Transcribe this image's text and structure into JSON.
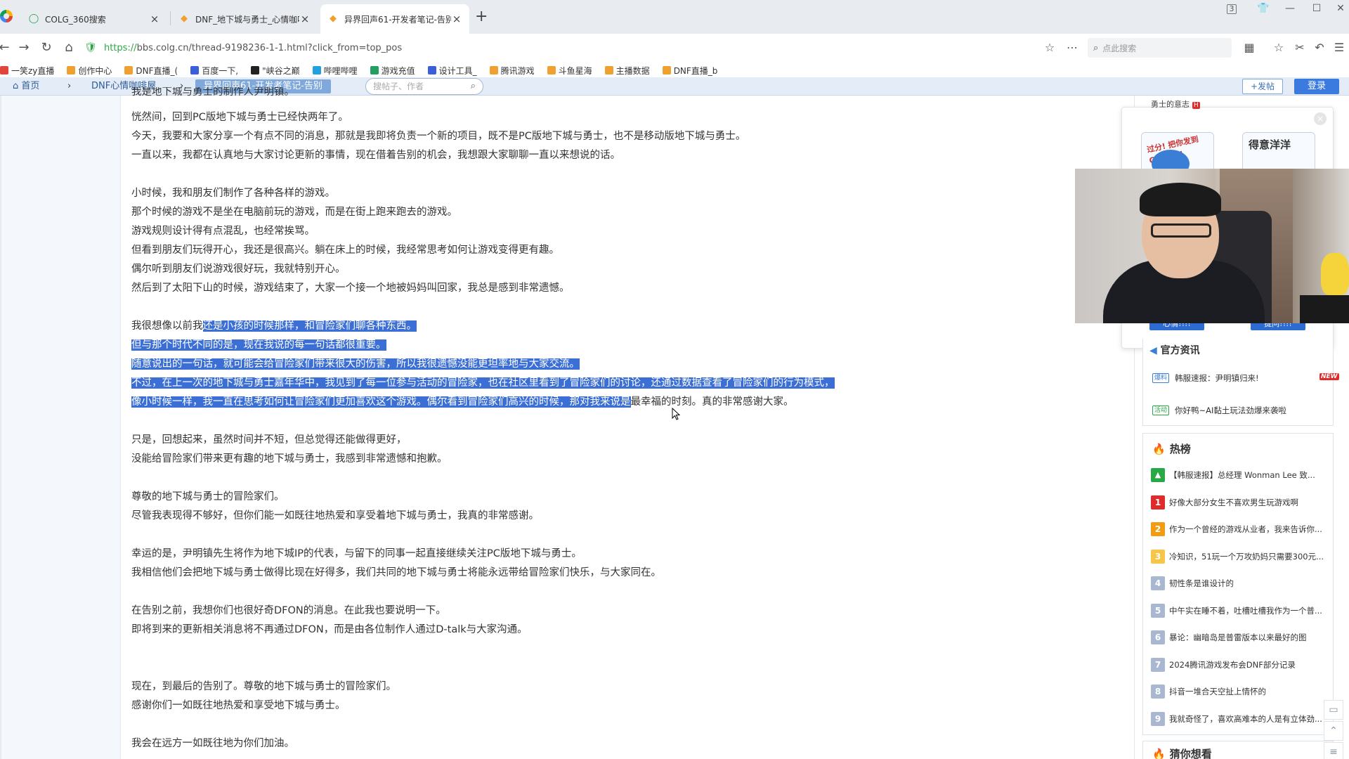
{
  "browser": {
    "tabs": [
      {
        "title": "COLG_360搜索",
        "icon": "search-circle-icon",
        "active": false
      },
      {
        "title": "DNF_地下城与勇士_心情咖啡屋",
        "icon": "colg-favicon-icon",
        "active": false
      },
      {
        "title": "异界回声61-开发者笔记-告别",
        "icon": "colg-favicon-icon",
        "active": true
      }
    ],
    "new_tab": "+",
    "tab_close": "×",
    "window_controls": {
      "counter": "3",
      "minimize": "—",
      "maximize": "☐",
      "close": "✕"
    },
    "url_secure": "https://",
    "url_rest": "bbs.colg.cn/thread-9198236-1-1.html?click_from=top_pos",
    "search_placeholder": "点此搜索",
    "bookmarks": [
      {
        "label": "一笑zy直播",
        "color": "#e0463a"
      },
      {
        "label": "创作中心",
        "color": "#f0a030"
      },
      {
        "label": "DNF直播_(",
        "color": "#f0a030"
      },
      {
        "label": "百度一下,",
        "color": "#3a5fd9"
      },
      {
        "label": "\"峡谷之巅",
        "color": "#222222"
      },
      {
        "label": "哔哩哔哩",
        "color": "#23a0e0"
      },
      {
        "label": "游戏充值",
        "color": "#23a060"
      },
      {
        "label": "设计工具_",
        "color": "#3a5fd9"
      },
      {
        "label": "腾讯游戏",
        "color": "#f0a030"
      },
      {
        "label": "斗鱼星海",
        "color": "#f0a030"
      },
      {
        "label": "主播数据",
        "color": "#f0a030"
      },
      {
        "label": "DNF直播_b",
        "color": "#f0a030"
      }
    ]
  },
  "site_nav": {
    "home": "首页",
    "forum": "DNF心情咖啡屋",
    "current": "异界回声61-开发者笔记-告别",
    "search_placeholder": "搜帖子、作者",
    "post_button": "+发帖",
    "login_button": "登录"
  },
  "article": {
    "top_partial": "我是地下城与勇士的制作人尹明镇。",
    "lines": [
      {
        "text": "恍然间，回到PC版地下城与勇士已经快两年了。"
      },
      {
        "text": "今天，我要和大家分享一个有点不同的消息，那就是我即将负责一个新的项目，既不是PC版地下城与勇士，也不是移动版地下城与勇士。"
      },
      {
        "text": "一直以来，我都在认真地与大家讨论更新的事情，现在借着告别的机会，我想跟大家聊聊一直以来想说的话。"
      },
      {
        "text": "小时候，我和朋友们制作了各种各样的游戏。"
      },
      {
        "text": "那个时候的游戏不是坐在电脑前玩的游戏，而是在街上跑来跑去的游戏。"
      },
      {
        "text": "游戏规则设计得有点混乱，也经常挨骂。"
      },
      {
        "text": "但看到朋友们玩得开心，我还是很高兴。躺在床上的时候，我经常思考如何让游戏变得更有趣。"
      },
      {
        "text": "偶尔听到朋友们说游戏很好玩，我就特别开心。"
      },
      {
        "text": "然后到了太阳下山的时候，游戏结束了，大家一个接一个地被妈妈叫回家，我总是感到非常遗憾。"
      },
      {
        "pre": "我很想像以前我",
        "hl": "还是小孩的时候那样，和冒险家们聊各种东西。",
        "post": ""
      },
      {
        "pre": "",
        "hl": "但与那个时代不同的是，现在我说的每一句话都很重要。",
        "post": ""
      },
      {
        "pre": "",
        "hl": "随意说出的一句话，就可能会给冒险家们带来很大的伤害，所以我很遗憾没能更坦率地与大家交流。",
        "post": ""
      },
      {
        "pre": "",
        "hl": "不过，在上一次的地下城与勇士嘉年华中，我见到了每一位参与活动的冒险家，也在社区里看到了冒险家们的讨论，还通过数据查看了冒险家们的行为模式，",
        "post": ""
      },
      {
        "pre": "",
        "hl": "像小时候一样，我一直在思考如何让冒险家们更加喜欢这个游戏。偶尔看到冒险家们高兴的时候，那对我来说是",
        "post": "最幸福的时刻。真的非常感谢大家。"
      },
      {
        "text": "只是，回想起来，虽然时间并不短，但总觉得还能做得更好，"
      },
      {
        "text": "没能给冒险家们带来更有趣的地下城与勇士，我感到非常遗憾和抱歉。"
      },
      {
        "text": "尊敬的地下城与勇士的冒险家们。"
      },
      {
        "text": "尽管我表现得不够好，但你们能一如既往地热爱和享受着地下城与勇士，我真的非常感谢。"
      },
      {
        "text": "幸运的是，尹明镇先生将作为地下城IP的代表，与留下的同事一起直接继续关注PC版地下城与勇士。"
      },
      {
        "text": "我相信他们会把地下城与勇士做得比现在好得多，我们共同的地下城与勇士将能永远带给冒险家们快乐，与大家同在。"
      },
      {
        "text": "在告别之前，我想你们也很好奇DFON的消息。在此我也要说明一下。"
      },
      {
        "text": "即将到来的更新相关消息将不再通过DFON，而是由各位制作人通过D-talk与大家沟通。"
      },
      {
        "text": "现在，到最后的告别了。尊敬的地下城与勇士的冒险家们。"
      },
      {
        "text": "感谢你们一如既往地热爱和享受地下城与勇士。"
      },
      {
        "text": "我会在远方一如既往地为你们加油。"
      }
    ]
  },
  "sidebar": {
    "popup": {
      "title": "勇士的意志",
      "tag": "H",
      "close": "×",
      "sticker_a": "过分! 把你发到COLG去!",
      "sticker_b": "得意洋洋",
      "button_a": "心情!!!!",
      "button_b": "提问!!!!"
    },
    "official_news": {
      "title": "官方资讯",
      "items": [
        {
          "badge": "爆料",
          "badge_class": "badge-blue",
          "text": "韩服速报：尹明镇归来!",
          "new": "NEW"
        },
        {
          "badge": "活动",
          "badge_class": "badge-green",
          "text": "你好鸭~AI黏土玩法劲爆来袭啦",
          "new": ""
        }
      ]
    },
    "hot": {
      "title": "热榜",
      "items": [
        {
          "rank": "▲",
          "class": "rank-top",
          "text": "【韩服速报】总经理 Wonman Lee 致..."
        },
        {
          "rank": "1",
          "class": "rank-1",
          "text": "好像大部分女生不喜欢男生玩游戏啊"
        },
        {
          "rank": "2",
          "class": "rank-2",
          "text": "作为一个曾经的游戏从业者，我来告诉你..."
        },
        {
          "rank": "3",
          "class": "rank-3",
          "text": "冷知识，51玩一个万攻奶妈只需要300元..."
        },
        {
          "rank": "4",
          "class": "",
          "text": "韧性条是谁设计的"
        },
        {
          "rank": "5",
          "class": "",
          "text": "中午实在睡不着，吐槽吐槽我作为一个普..."
        },
        {
          "rank": "6",
          "class": "",
          "text": "暴论：幽暗岛是普雷版本以来最好的图"
        },
        {
          "rank": "7",
          "class": "",
          "text": "2024腾讯游戏发布会DNF部分记录"
        },
        {
          "rank": "8",
          "class": "",
          "text": "抖音一堆合天空扯上情怀的"
        },
        {
          "rank": "9",
          "class": "",
          "text": "我就奇怪了，喜欢高难本的人是有立体劲..."
        }
      ]
    },
    "guess": {
      "title": "猜你想看"
    }
  }
}
